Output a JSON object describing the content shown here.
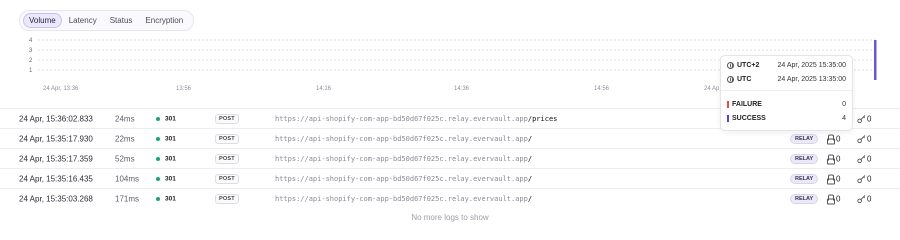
{
  "tabs": [
    {
      "label": "Volume",
      "active": true
    },
    {
      "label": "Latency",
      "active": false
    },
    {
      "label": "Status",
      "active": false
    },
    {
      "label": "Encryption",
      "active": false
    }
  ],
  "chart_data": {
    "type": "bar",
    "title": "",
    "xlabel": "",
    "ylabel": "",
    "yticks": [
      "4",
      "3",
      "2",
      "1"
    ],
    "ylim": [
      0,
      4
    ],
    "xticks": [
      "24 Apr, 13:36",
      "13:56",
      "14:16",
      "14:36",
      "14:56",
      "24 Ap"
    ],
    "grid": true,
    "series": [
      {
        "name": "FAILURE",
        "color": "#e5484d",
        "points": [
          {
            "x": "24 Apr, 2025 13:35:00",
            "y": 0
          }
        ]
      },
      {
        "name": "SUCCESS",
        "color": "#6e56cf",
        "points": [
          {
            "x": "24 Apr, 2025 13:35:00",
            "y": 4
          }
        ]
      }
    ]
  },
  "tooltip": {
    "tz1_label": "UTC+2",
    "tz1_value": "24 Apr, 2025 15:35:00",
    "tz2_label": "UTC",
    "tz2_value": "24 Apr, 2025 13:35:00",
    "failure_label": "FAILURE",
    "failure_value": "0",
    "success_label": "SUCCESS",
    "success_value": "4",
    "failure_color": "#e5484d",
    "success_color": "#5b3fd6"
  },
  "status_color": "#1aa37a",
  "logs": [
    {
      "time": "24 Apr, 15:36:02.833",
      "duration": "24ms",
      "status": "301",
      "method": "POST",
      "url_base": "https://api-shopify-com-app-bd50d67f025c.relay.evervault.app",
      "path": "/prices",
      "relay": "",
      "lock_count": "",
      "key_count": "0"
    },
    {
      "time": "24 Apr, 15:35:17.930",
      "duration": "22ms",
      "status": "301",
      "method": "POST",
      "url_base": "https://api-shopify-com-app-bd50d67f025c.relay.evervault.app",
      "path": "/",
      "relay": "RELAY",
      "lock_count": "0",
      "key_count": "0"
    },
    {
      "time": "24 Apr, 15:35:17.359",
      "duration": "52ms",
      "status": "301",
      "method": "POST",
      "url_base": "https://api-shopify-com-app-bd50d67f025c.relay.evervault.app",
      "path": "/",
      "relay": "RELAY",
      "lock_count": "0",
      "key_count": "0"
    },
    {
      "time": "24 Apr, 15:35:16.435",
      "duration": "104ms",
      "status": "301",
      "method": "POST",
      "url_base": "https://api-shopify-com-app-bd50d67f025c.relay.evervault.app",
      "path": "/",
      "relay": "RELAY",
      "lock_count": "0",
      "key_count": "0"
    },
    {
      "time": "24 Apr, 15:35:03.268",
      "duration": "171ms",
      "status": "301",
      "method": "POST",
      "url_base": "https://api-shopify-com-app-bd50d67f025c.relay.evervault.app",
      "path": "/",
      "relay": "RELAY",
      "lock_count": "0",
      "key_count": "0"
    }
  ],
  "footer_text": "No more logs to show"
}
